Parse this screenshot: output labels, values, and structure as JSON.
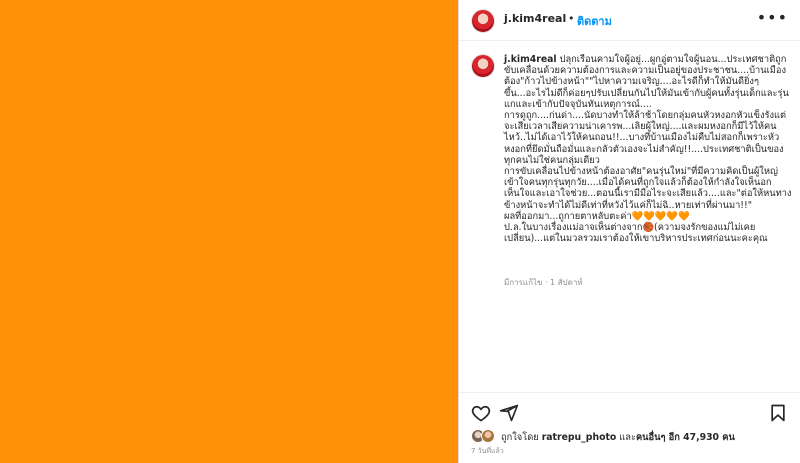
{
  "colors": {
    "media_bg": "#ff9008",
    "follow_accent": "#0095f6",
    "emoji_hearts": "#f2751a"
  },
  "header": {
    "username": "j.kim4real",
    "separator": "•",
    "follow_label": "ติดตาม",
    "more_icon": "more-horizontal-icon"
  },
  "caption": {
    "username": "j.kim4real",
    "text": "ปลุกเรือนคามใจผู้อยู่...ผูกอู่ตามใจผู้นอน...ประเทศชาติถูกขับเคลื่อนด้วยความต้องการและความเป็นอยู่ของประชาชน....บ้านเมืองต้อง\"ก้าวไปข้างหน้า\"\"ไปหาความเจริญ....อะไรดีก็ทำให้มันดียิ่งๆขึ้น...อะไรไม่ดีก็ค่อยๆปรับเปลี่ยนกันไปให้มันเข้ากับผู้คนทั้งรุ่นเด็กและรุ่นแกและเข้ากับปัจจุบันทันเหตุการณ์....\nการดูถูก....ก่นด่า....นัดบางทำให้ล้าช้าโดยกลุ่มคนหัวหงอกหัวแข็งรังแต่จะเสียเวลาเสียความน่าเคารพ...เลิยผู้ใหญ่....และผมหงอกก็มีไว้ให้คนไหว้..ไม่ได้เอาไว้ให้คนถอน!!...บางที่บ้านเมืองไม่คืบไม่สอกก็เพราะหัวหงอกที่ยึดมั่นถือมั่นและกลัวตัวเองจะไม่สำคัญ!!....ประเทศชาติเป็นของทุกคนไม่ใช่คนกลุ่มเดียว\nการขับเคลื่อนไปข้างหน้าต้องอาศัย\"คนรุ่นใหม่\"ที่มีความคิดเป็นผู้ใหญ่เข้าใจคนทุกรุ่นทุกวัย....เมื่อได้คนที่ถูกใจแล้วก็ต้องให้กำลังใจเห็นอกเห็นใจและเอาใจช่วย...ตอนนี้เรามีมือไระจะเสียแล้ว....และ\"ต่อให้หนทางข้างหน้าจะทำได้ไม่ดีเท่าที่หวังไว้แค่ก็ไม่ฉิ..หายเท่าที่ผ่านมา!!\"\nผลที่ออกมา...ถูกายตาหลับตะค่า🧡🧡🧡🧡🧡\nป.ล.ในบางเรื่องแม่อาจเห็นต่างจาก🏀(ความจงรักของแม่ไม่เคยเปลี่ยน)...แต่ในมวลรวมเราต้องให้เขาบริหารประเทศก่อนนะคะคุณ",
    "meta": "มีการแก้ไข · 1 สัปดาห์"
  },
  "actions": {
    "like_icon": "heart-icon",
    "share_icon": "share-icon",
    "save_icon": "bookmark-icon"
  },
  "likes": {
    "prefix": "ถูกใจโดย ",
    "liker": "ratrepu_photo",
    "middle": " และ",
    "others_label": "คนอื่นๆ อีก 47,930 คน"
  },
  "date": "7 วันที่แล้ว"
}
